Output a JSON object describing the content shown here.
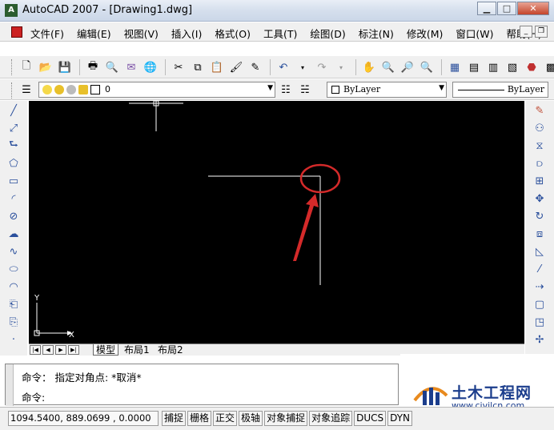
{
  "window": {
    "title": "AutoCAD 2007 - [Drawing1.dwg]",
    "logo_text": "A",
    "minimize": "▁",
    "maximize": "□",
    "close": "✕"
  },
  "menu": {
    "items": [
      "文件(F)",
      "编辑(E)",
      "视图(V)",
      "插入(I)",
      "格式(O)",
      "工具(T)",
      "绘图(D)",
      "标注(N)",
      "修改(M)",
      "窗口(W)",
      "帮助(H)"
    ],
    "mdi_min": "_",
    "mdi_restore": "❐"
  },
  "layers": {
    "current": "0",
    "color": "ByLayer",
    "linetype": "ByLayer"
  },
  "tabs": [
    "模型",
    "布局1",
    "布局2"
  ],
  "command": {
    "history": "命令： 指定对角点: *取消*",
    "prompt": "命令:"
  },
  "status": {
    "coordinates": "1094.5400, 889.0699 , 0.0000",
    "toggles": [
      "捕捉",
      "栅格",
      "正交",
      "极轴",
      "对象捕捉",
      "对象追踪",
      "DUCS",
      "DYN"
    ]
  },
  "watermark": {
    "title": "土木工程网",
    "url": "www.civilcn.com"
  },
  "canvas": {
    "ucs_y": "Y",
    "ucs_x": "X",
    "highlight_color": "#d42a2a"
  }
}
